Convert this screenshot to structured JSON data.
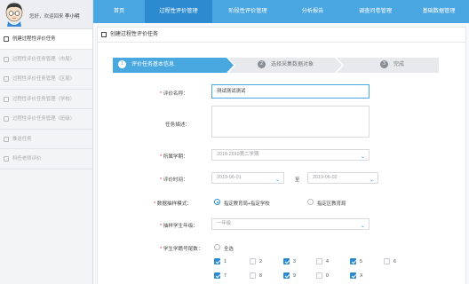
{
  "sidebar": {
    "greeting": "您好，欢迎回来",
    "username": "李小明",
    "items": [
      {
        "label": "创建过程性评价任务"
      },
      {
        "label": "过程性评价任务管理（市局）"
      },
      {
        "label": "过程性评价任务管理（区局）"
      },
      {
        "label": "过程性评价任务管理（学校）"
      },
      {
        "label": "过程性评价任务管理（班级）"
      },
      {
        "label": "推送任务"
      },
      {
        "label": "科任老师评价"
      }
    ]
  },
  "topnav": {
    "items": [
      {
        "label": "首页"
      },
      {
        "label": "过程性评价管理"
      },
      {
        "label": "阶段性评价管理"
      },
      {
        "label": "分析报告"
      },
      {
        "label": "调查问卷管理"
      },
      {
        "label": "基础数据管理"
      }
    ],
    "active_index": 1
  },
  "panel": {
    "title": "创建过程性评价任务"
  },
  "steps": [
    {
      "num": "1",
      "label": "评价任务基本信息"
    },
    {
      "num": "2",
      "label": "选择采集数据对象"
    },
    {
      "num": "3",
      "label": "完成"
    }
  ],
  "form": {
    "name_label": "评价名称：",
    "name_value": "测试测试测试",
    "desc_label": "任务描述：",
    "term_label": "所属学期：",
    "term_value": "2018-2019第二学期",
    "time_label": "评价时间：",
    "time_start": "2019-06-01",
    "time_sep": "至",
    "time_end": "2019-06-02",
    "source_label": "数据抽样模式：",
    "source_options": [
      "指定教育局+指定学校",
      "指定区教育局"
    ],
    "grade_label": "抽样学生年级：",
    "grade_value": "一年级",
    "class_label": "学生学籍号尾数：",
    "all_label": "全选",
    "digits": [
      "1",
      "2",
      "3",
      "4",
      "5",
      "6",
      "7",
      "8",
      "9",
      "0",
      "X"
    ],
    "digits_checked": [
      true,
      false,
      true,
      false,
      true,
      false,
      true,
      false,
      true,
      false,
      true
    ]
  },
  "colors": {
    "accent": "#4aa6e0",
    "accent_dark": "#2c8ad0",
    "step_active": "#49a8df",
    "step_inactive": "#e7e9ec"
  }
}
